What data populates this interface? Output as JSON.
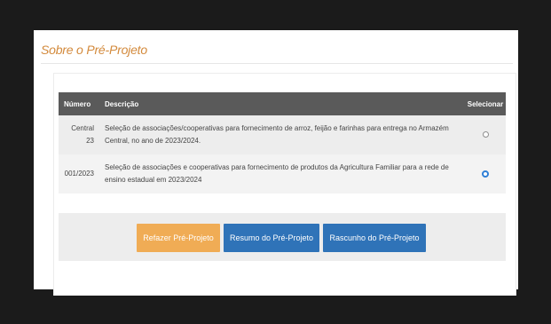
{
  "panel": {
    "title": "Sobre o Pré-Projeto"
  },
  "table": {
    "headers": {
      "numero": "Número",
      "descricao": "Descrição",
      "selecionar": "Selecionar"
    },
    "rows": [
      {
        "numero_line1": "Central",
        "numero_line2": "23",
        "descricao": "Seleção de associações/cooperativas para fornecimento de arroz, feijão e farinhas para entrega no Armazém Central, no ano de 2023/2024.",
        "selected": false
      },
      {
        "numero_line1": "001/2023",
        "numero_line2": "",
        "descricao": "Seleção de associações e cooperativas para fornecimento de produtos da Agricultura Familiar para a rede de ensino estadual em 2023/2024",
        "selected": true
      }
    ]
  },
  "buttons": {
    "refazer": "Refazer Pré-Projeto",
    "resumo": "Resumo do Pré-Projeto",
    "rascunho": "Rascunho do Pré-Projeto"
  },
  "colors": {
    "title_accent": "#d38a3c",
    "header_bg": "#5a5a5a",
    "button_orange": "#f0ac55",
    "button_blue": "#2f73b8",
    "radio_selected": "#2f7fd6"
  }
}
